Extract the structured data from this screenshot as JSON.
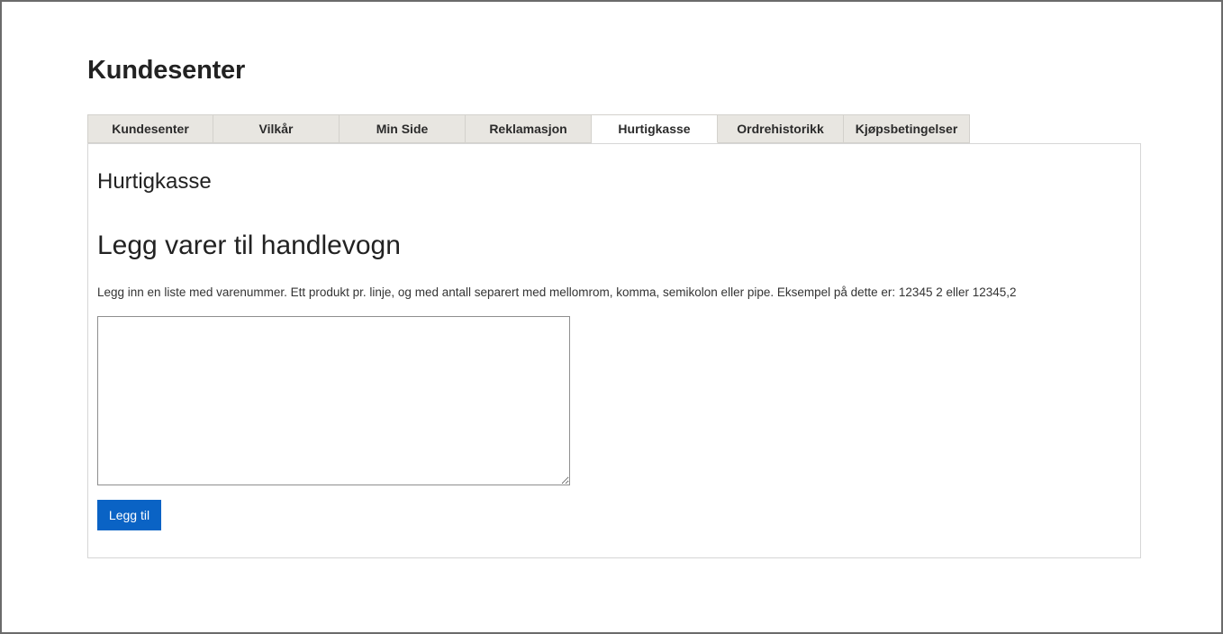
{
  "page": {
    "title": "Kundesenter"
  },
  "tabs": [
    {
      "label": "Kundesenter",
      "active": false
    },
    {
      "label": "Vilkår",
      "active": false
    },
    {
      "label": "Min Side",
      "active": false
    },
    {
      "label": "Reklamasjon",
      "active": false
    },
    {
      "label": "Hurtigkasse",
      "active": true
    },
    {
      "label": "Ordrehistorikk",
      "active": false
    },
    {
      "label": "Kjøpsbetingelser",
      "active": false
    }
  ],
  "panel": {
    "section_title": "Hurtigkasse",
    "subsection_title": "Legg varer til handlevogn",
    "instructions": "Legg inn en liste med varenummer. Ett produkt pr. linje, og med antall separert med mellomrom, komma, semikolon eller pipe. Eksempel på dette er: 12345 2 eller 12345,2",
    "textarea_value": "",
    "add_button_label": "Legg til"
  },
  "colors": {
    "tab_background": "#e8e6e1",
    "tab_active_background": "#ffffff",
    "button_primary": "#0a63c5",
    "text_primary": "#222222"
  }
}
